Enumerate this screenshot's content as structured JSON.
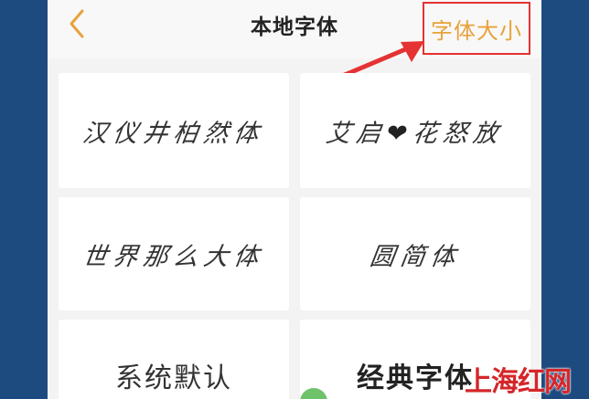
{
  "header": {
    "title": "本地字体",
    "font_size_label": "字体大小"
  },
  "fonts": [
    {
      "label": "汉仪井柏然体"
    },
    {
      "label_left": "艾启",
      "label_right": "花怒放"
    },
    {
      "label": "世界那么大体"
    },
    {
      "label": "圆简体"
    },
    {
      "label": "系统默认"
    },
    {
      "label": "经典字体"
    }
  ],
  "watermark": "上海红网",
  "colors": {
    "accent": "#e8a23a",
    "highlight_box": "#e53232",
    "background_frame": "#1d4b80"
  },
  "icons": {
    "back": "chevron-left-icon",
    "heart": "heart-icon",
    "arrow": "red-arrow-annotation"
  }
}
